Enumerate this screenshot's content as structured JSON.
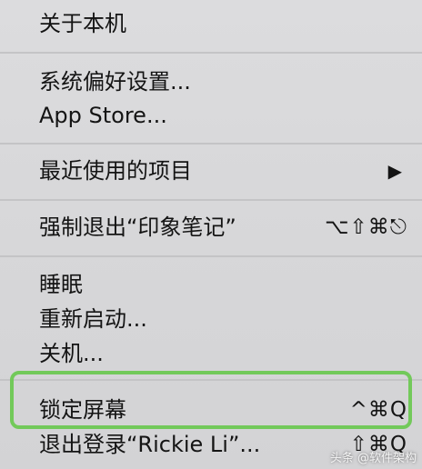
{
  "menu": {
    "about": {
      "label": "关于本机"
    },
    "preferences": {
      "label": "系统偏好设置..."
    },
    "app_store": {
      "label": "App Store..."
    },
    "recent_items": {
      "label": "最近使用的项目",
      "submenu_arrow": "▶"
    },
    "force_quit": {
      "label": "强制退出“印象笔记”",
      "shortcut": "⌥⇧⌘⎋"
    },
    "sleep": {
      "label": "睡眠"
    },
    "restart": {
      "label": "重新启动..."
    },
    "shutdown": {
      "label": "关机..."
    },
    "lock_screen": {
      "label": "锁定屏幕",
      "shortcut": "^⌘Q"
    },
    "logout": {
      "label": "退出登录“Rickie Li”...",
      "shortcut": "⇧⌘Q"
    }
  },
  "highlight_color": "#72c95a",
  "watermark": {
    "text": "头条 @软件架构"
  }
}
